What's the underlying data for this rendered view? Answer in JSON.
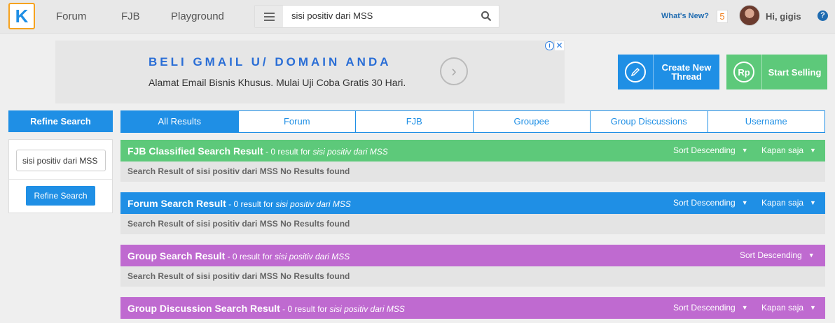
{
  "topbar": {
    "logo_letter": "K",
    "nav": [
      "Forum",
      "FJB",
      "Playground"
    ],
    "search_value": "sisi positiv dari MSS",
    "whats_new": "What's New?",
    "notification_count": "5",
    "greeting": "Hi, gigis",
    "help": "?"
  },
  "ad": {
    "title": "BELI GMAIL U/ DOMAIN ANDA",
    "subtitle": "Alamat Email Bisnis Khusus. Mulai Uji Coba Gratis 30 Hari.",
    "info_glyph": "i",
    "close_glyph": "✕"
  },
  "actions": {
    "create_line1": "Create New",
    "create_line2": "Thread",
    "sell_icon": "Rp",
    "sell_label": "Start Selling"
  },
  "sidebar": {
    "heading": "Refine Search",
    "input_value": "sisi positiv dari MSS",
    "button": "Refine Search"
  },
  "tabs": [
    "All Results",
    "Forum",
    "FJB",
    "Groupee",
    "Group Discussions",
    "Username"
  ],
  "sections": [
    {
      "title": "FJB Classified Search Result",
      "count": " - 0 result for ",
      "query": "sisi positiv dari MSS",
      "sort": "Sort Descending",
      "time": "Kapan saja",
      "body": "Search Result of sisi positiv dari MSS No Results found",
      "color": "#5dc97a"
    },
    {
      "title": "Forum Search Result",
      "count": " - 0 result for ",
      "query": "sisi positiv dari MSS",
      "sort": "Sort Descending",
      "time": "Kapan saja",
      "body": "Search Result of sisi positiv dari MSS No Results found",
      "color": "#1f8fe5"
    },
    {
      "title": "Group Search Result",
      "count": " - 0 result for ",
      "query": "sisi positiv dari MSS",
      "sort": "Sort Descending",
      "body": "Search Result of sisi positiv dari MSS No Results found",
      "color": "#bf6ad0"
    },
    {
      "title": "Group Discussion Search Result",
      "count": " - 0 result for ",
      "query": "sisi positiv dari MSS",
      "sort": "Sort Descending",
      "time": "Kapan saja",
      "color": "#bf6ad0"
    }
  ]
}
